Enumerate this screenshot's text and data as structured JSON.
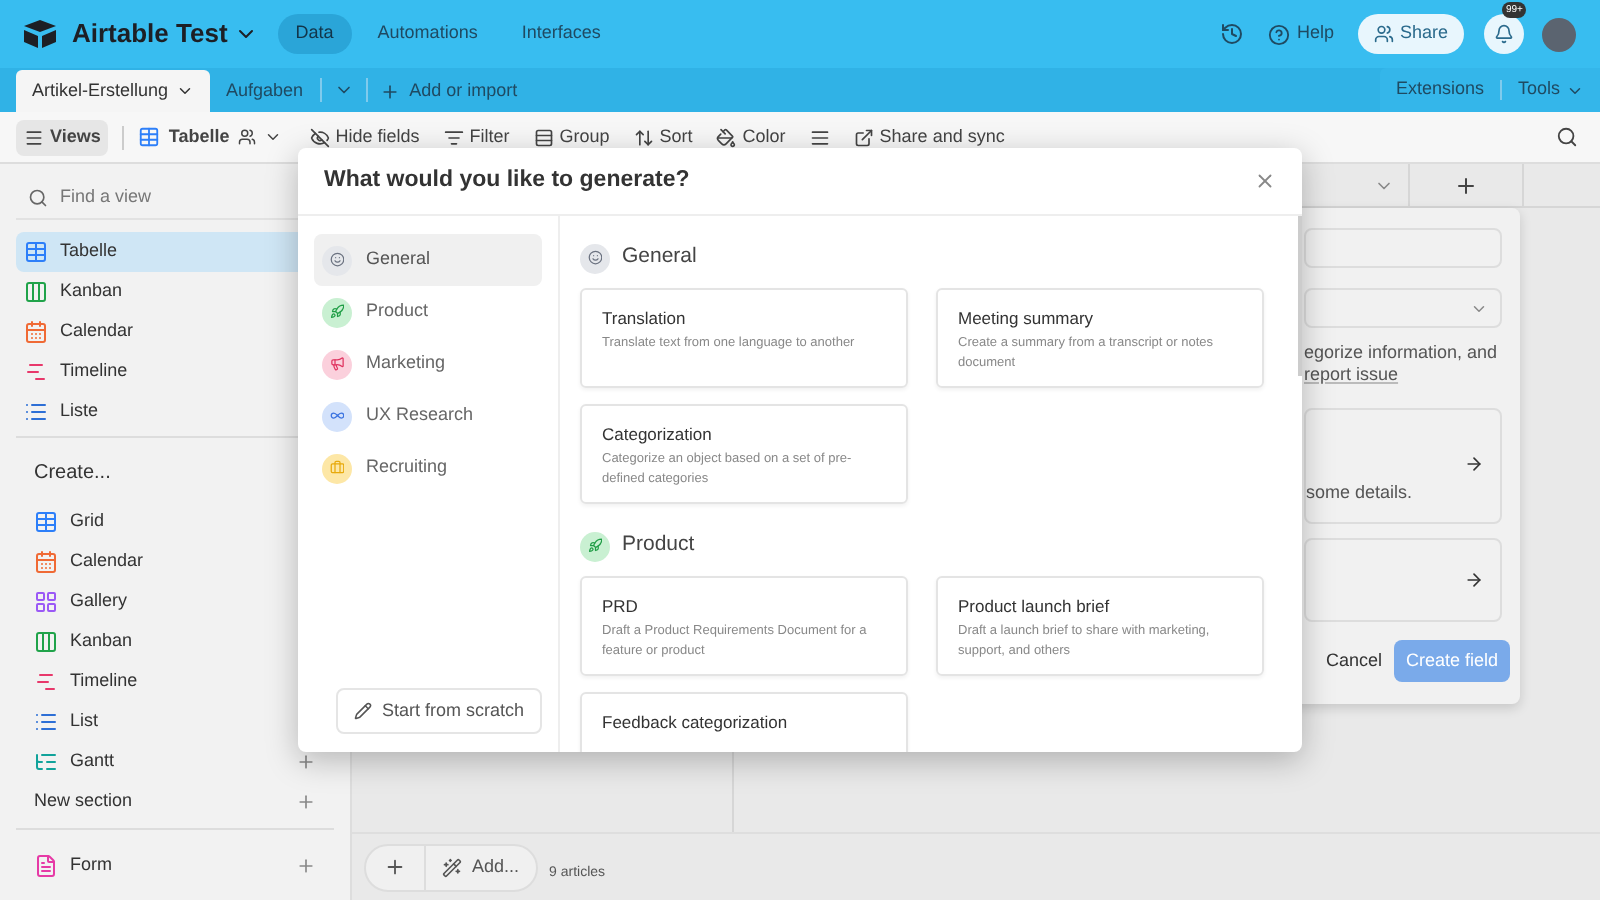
{
  "app": {
    "title": "Airtable Test",
    "nav": [
      {
        "label": "Data",
        "selected": true
      },
      {
        "label": "Automations",
        "selected": false
      },
      {
        "label": "Interfaces",
        "selected": false
      }
    ],
    "help": "Help",
    "share": "Share",
    "notification_badge": "99+"
  },
  "tabs": [
    {
      "label": "Artikel-Erstellung",
      "selected": true
    },
    {
      "label": "Aufgaben",
      "selected": false
    }
  ],
  "add_import": "Add or import",
  "extensions": "Extensions",
  "tools": "Tools",
  "toolbar": {
    "views": "Views",
    "view_name": "Tabelle",
    "buttons": [
      {
        "label": "Hide fields",
        "kind": "hide"
      },
      {
        "label": "Filter",
        "kind": "filter"
      },
      {
        "label": "Group",
        "kind": "group"
      },
      {
        "label": "Sort",
        "kind": "sort"
      },
      {
        "label": "Color",
        "kind": "color"
      },
      {
        "kind": "rowheight"
      },
      {
        "label": "Share and sync",
        "kind": "share"
      }
    ]
  },
  "sidebar": {
    "search": {
      "placeholder": "Find a view"
    },
    "views": [
      {
        "label": "Tabelle",
        "kind": "grid",
        "selected": true
      },
      {
        "label": "Kanban",
        "kind": "kanban",
        "selected": false
      },
      {
        "label": "Calendar",
        "kind": "calendar",
        "selected": false
      },
      {
        "label": "Timeline",
        "kind": "timeline",
        "selected": false
      },
      {
        "label": "Liste",
        "kind": "list",
        "selected": false
      }
    ],
    "create_heading": "Create...",
    "create_items": [
      {
        "label": "Grid",
        "kind": "grid"
      },
      {
        "label": "Calendar",
        "kind": "calendar"
      },
      {
        "label": "Gallery",
        "kind": "gallery"
      },
      {
        "label": "Kanban",
        "kind": "kanban"
      },
      {
        "label": "Timeline",
        "kind": "timeline"
      },
      {
        "label": "List",
        "kind": "list"
      },
      {
        "label": "Gantt",
        "kind": "gantt"
      }
    ],
    "new_section": "New section",
    "form": {
      "label": "Form",
      "kind": "form"
    }
  },
  "grid_footer": {
    "add": "Add...",
    "count": "9 articles"
  },
  "field_popover": {
    "description": "egorize information, and",
    "link": "report issue",
    "option_detail": "some details.",
    "cancel": "Cancel",
    "create": "Create field"
  },
  "modal": {
    "title": "What would you like to generate?",
    "categories": [
      {
        "label": "General",
        "kind": "general",
        "selected": true
      },
      {
        "label": "Product",
        "kind": "product",
        "selected": false
      },
      {
        "label": "Marketing",
        "kind": "marketing",
        "selected": false
      },
      {
        "label": "UX Research",
        "kind": "ux",
        "selected": false
      },
      {
        "label": "Recruiting",
        "kind": "recruiting",
        "selected": false
      }
    ],
    "start_button": "Start from scratch",
    "sections": [
      {
        "heading": "General",
        "kind": "general",
        "cards": [
          {
            "title": "Translation",
            "description": "Translate text from one language to another"
          },
          {
            "title": "Meeting summary",
            "description": "Create a summary from a transcript or notes document"
          },
          {
            "title": "Categorization",
            "description": "Categorize an object based on a set of pre-defined categories"
          }
        ]
      },
      {
        "heading": "Product",
        "kind": "product",
        "cards": [
          {
            "title": "PRD",
            "description": "Draft a Product Requirements Document for a feature or product"
          },
          {
            "title": "Product launch brief",
            "description": "Draft a launch brief to share with marketing, support, and others"
          },
          {
            "title": "Feedback categorization"
          }
        ]
      }
    ]
  }
}
